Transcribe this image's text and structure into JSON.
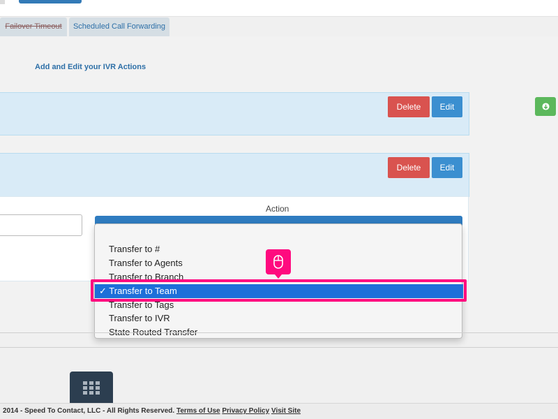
{
  "tabs": [
    {
      "label": "Failover Timeout",
      "struck": true
    },
    {
      "label": "Scheduled Call Forwarding",
      "struck": false
    }
  ],
  "section_title": "Add and Edit your IVR Actions",
  "panels": [
    {
      "delete_label": "Delete",
      "edit_label": "Edit"
    },
    {
      "delete_label": "Delete",
      "edit_label": "Edit"
    }
  ],
  "action": {
    "label": "Action",
    "selected_value": "Transfer to Team",
    "options": [
      "Transfer to #",
      "Transfer to Agents",
      "Transfer to Branch",
      "Transfer to Team",
      "Transfer to Tags",
      "Transfer to IVR",
      "State Routed Transfer"
    ],
    "checkmark": "✓"
  },
  "footer": {
    "copyright": "2014 - Speed To Contact, LLC - All Rights Reserved.",
    "links": [
      "Terms of Use",
      "Privacy Policy",
      "Visit Site"
    ]
  },
  "icons": {
    "green_button": "arrow-circle-icon",
    "mouse_badge": "mouse-icon",
    "keypad": "grid-icon"
  },
  "colors": {
    "highlight": "#ff0a7f",
    "selected_option": "#1e6fd9",
    "delete": "#d9534f",
    "edit": "#3b8fd0",
    "green": "#5cb85c"
  }
}
